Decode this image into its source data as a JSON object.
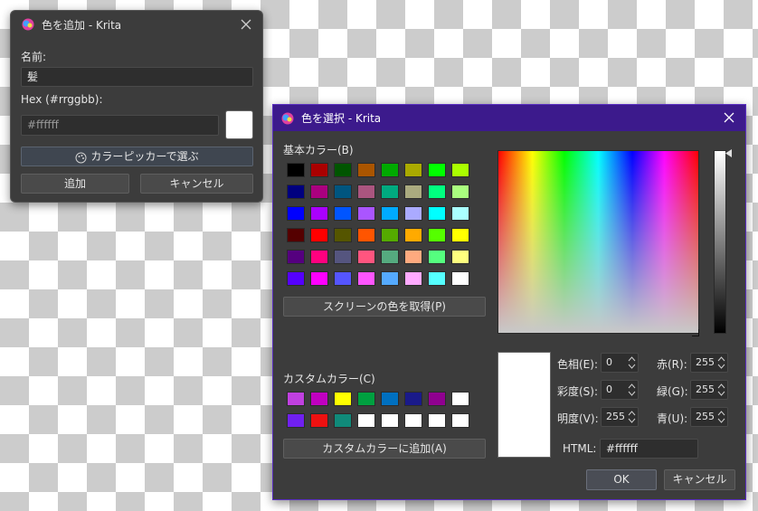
{
  "add_dialog": {
    "title": "色を追加 - Krita",
    "name_label": "名前:",
    "name_value": "髪",
    "hex_label": "Hex (#rrggbb):",
    "hex_value": "#ffffff",
    "preview_color": "#ffffff",
    "picker_button": "カラーピッカーで選ぶ",
    "add_button": "追加",
    "cancel_button": "キャンセル"
  },
  "select_dialog": {
    "title": "色を選択 - Krita",
    "accent_color": "#3c1a8c",
    "basic_colors_label": "基本カラー(B)",
    "basic_colors": [
      "#000000",
      "#aa0000",
      "#005500",
      "#aa5500",
      "#00aa00",
      "#aaaa00",
      "#00ff00",
      "#aaff00",
      "#00007f",
      "#aa007f",
      "#00557f",
      "#aa557f",
      "#00aa7f",
      "#aaaa7f",
      "#00ff7f",
      "#aaff7f",
      "#0000ff",
      "#aa00ff",
      "#0055ff",
      "#aa55ff",
      "#00aaff",
      "#aaaaff",
      "#00ffff",
      "#aaffff",
      "#550000",
      "#ff0000",
      "#555500",
      "#ff5500",
      "#55aa00",
      "#ffaa00",
      "#55ff00",
      "#ffff00",
      "#55007f",
      "#ff007f",
      "#55557f",
      "#ff557f",
      "#55aa7f",
      "#ffaa7f",
      "#55ff7f",
      "#ffff7f",
      "#5500ff",
      "#ff00ff",
      "#5555ff",
      "#ff55ff",
      "#55aaff",
      "#ffaaff",
      "#55ffff",
      "#ffffff"
    ],
    "pick_screen_button": "スクリーンの色を取得(P)",
    "custom_colors_label": "カスタムカラー(C)",
    "custom_colors": [
      "#c040e0",
      "#c000c0",
      "#ffff00",
      "#00a040",
      "#0070c0",
      "#1a1a8a",
      "#900090",
      "#ffffff",
      "#7020f0",
      "#ee1111",
      "#108a7a",
      "#ffffff",
      "#ffffff",
      "#ffffff",
      "#ffffff",
      "#ffffff"
    ],
    "add_custom_button": "カスタムカラーに追加(A)",
    "hue_label": "色相(E):",
    "hue_value": "0",
    "sat_label": "彩度(S):",
    "sat_value": "0",
    "val_label": "明度(V):",
    "val_value": "255",
    "red_label": "赤(R):",
    "red_value": "255",
    "green_label": "緑(G):",
    "green_value": "255",
    "blue_label": "青(U):",
    "blue_value": "255",
    "html_label": "HTML:",
    "html_value": "#ffffff",
    "current_color": "#ffffff",
    "ok_button": "OK",
    "cancel_button": "キャンセル"
  }
}
